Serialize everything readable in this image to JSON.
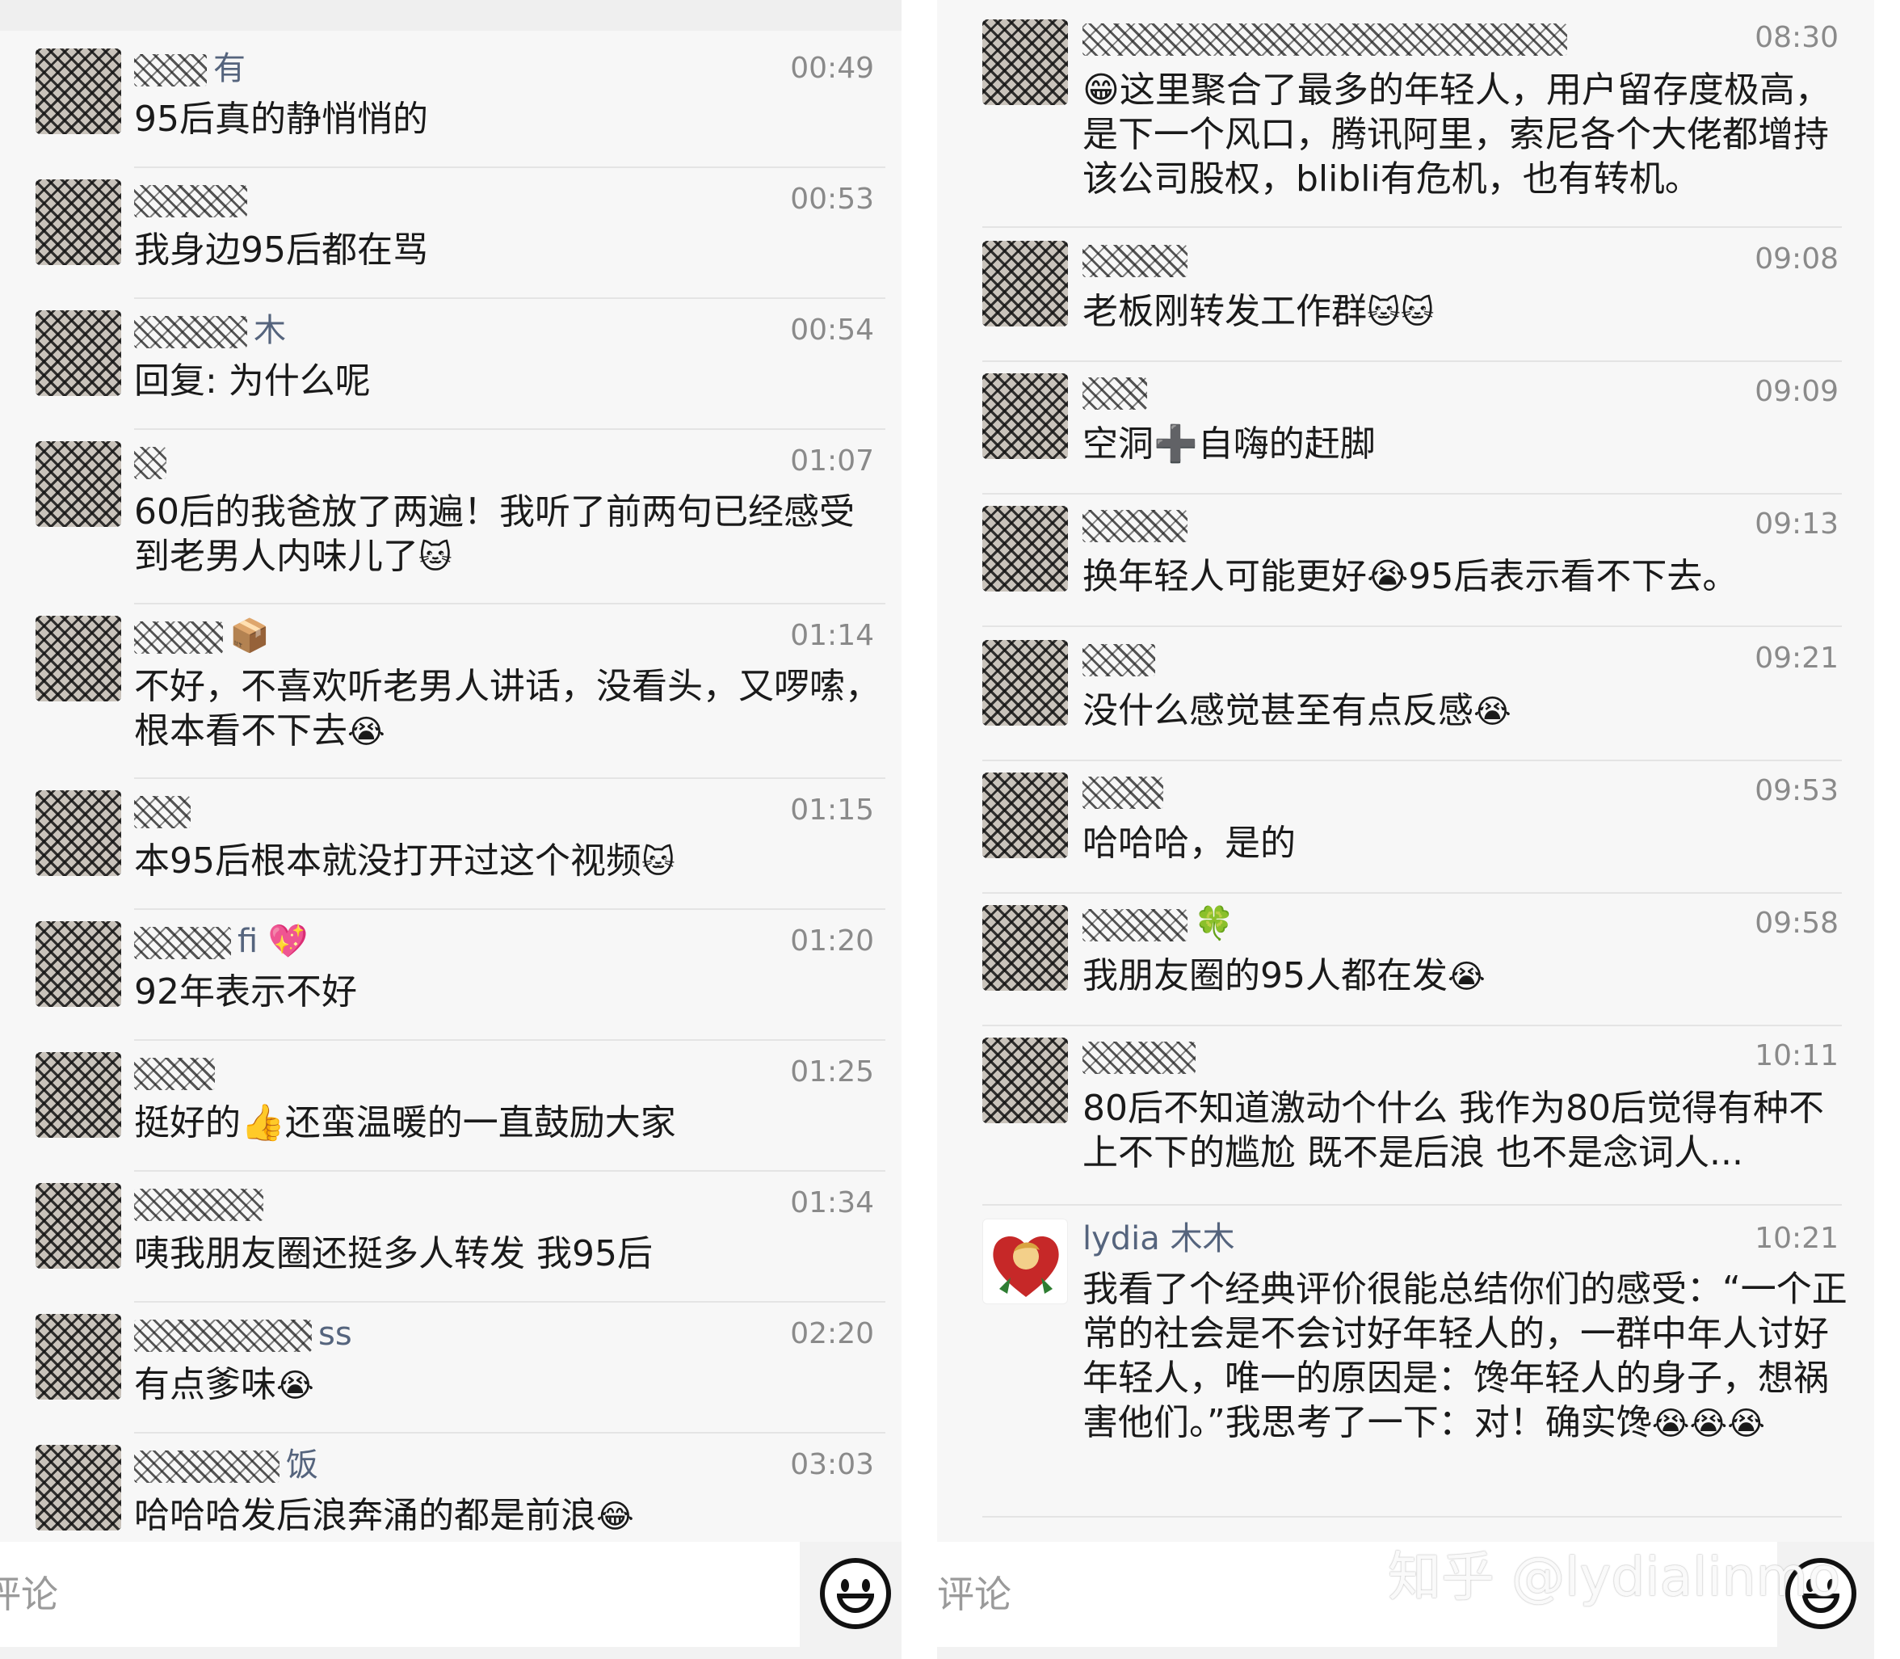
{
  "left": {
    "messages": [
      {
        "name_visible": "有",
        "time": "00:49",
        "text": "95后真的静悄悄的"
      },
      {
        "name_visible": "",
        "time": "00:53",
        "text": "我身边95后都在骂"
      },
      {
        "name_visible": "木",
        "time": "00:54",
        "text": "回复: 为什么呢"
      },
      {
        "name_visible": "",
        "time": "01:07",
        "text": "60后的我爸放了两遍！我听了前两句已经感受到老男人内味儿了"
      },
      {
        "name_visible": "",
        "time": "01:14",
        "text": "不好，不喜欢听老男人讲话，没看头，又啰嗦，根本看不下去"
      },
      {
        "name_visible": "",
        "time": "01:15",
        "text": "本95后根本就没打开过这个视频"
      },
      {
        "name_visible": "fi",
        "time": "01:20",
        "text": "92年表示不好"
      },
      {
        "name_visible": "",
        "time": "01:25",
        "text": "挺好的👍还蛮温暖的一直鼓励大家"
      },
      {
        "name_visible": "",
        "time": "01:34",
        "text": "咦我朋友圈还挺多人转发 我95后"
      },
      {
        "name_visible": "ss",
        "time": "02:20",
        "text": "有点爹味"
      },
      {
        "name_visible": "饭",
        "time": "03:03",
        "text": "哈哈哈发后浪奔涌的都是前浪"
      }
    ],
    "input_placeholder": "评论"
  },
  "right": {
    "messages": [
      {
        "name_visible": "",
        "time": "08:30",
        "text": "😁这里聚合了最多的年轻人，用户留存度极高，是下一个风口，腾讯阿里，索尼各个大佬都增持该公司股权，blibli有危机，也有转机。"
      },
      {
        "name_visible": "",
        "time": "09:08",
        "text": "老板刚转发工作群"
      },
      {
        "name_visible": "",
        "time": "09:09",
        "text": "空洞➕自嗨的赶脚"
      },
      {
        "name_visible": "",
        "time": "09:13",
        "text": "换年轻人可能更好😭95后表示看不下去。"
      },
      {
        "name_visible": "",
        "time": "09:21",
        "text": "没什么感觉甚至有点反感"
      },
      {
        "name_visible": "",
        "time": "09:53",
        "text": "哈哈哈，是的"
      },
      {
        "name_visible": "🍀",
        "time": "09:58",
        "text": "我朋友圈的95人都在发"
      },
      {
        "name_visible": "",
        "time": "10:11",
        "text": "80后不知道激动个什么 我作为80后觉得有种不上不下的尴尬 既不是后浪 也不是念词人..."
      },
      {
        "name_visible": "lydia 木木",
        "time": "10:21",
        "text": "我看了个经典评价很能总结你们的感受：“一个正常的社会是不会讨好年轻人的，一群中年人讨好年轻人，唯一的原因是：馋年轻人的身子，想祸害他们。”我思考了一下：对！确实馋"
      }
    ],
    "input_placeholder": "评论"
  },
  "watermark": "知乎 @lydialinmo",
  "icons": {
    "emoji_button": "smiley-face-icon",
    "tear_laugh": "😭",
    "cat": "🐱",
    "thumbs": "👍",
    "heart": "💖",
    "clover": "🍀",
    "box": "📦",
    "laugh": "😂"
  },
  "colors": {
    "name": "#55647d",
    "time": "#8a8a8a",
    "text": "#1a1a1a",
    "bg": "#f7f7f7"
  }
}
